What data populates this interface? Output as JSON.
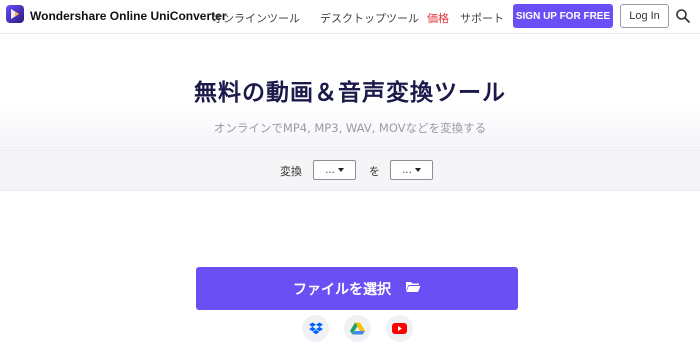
{
  "header": {
    "brand": "Wondershare Online UniConverter",
    "nav": [
      "オンラインツール",
      "デスクトップツール",
      "価格",
      "サポート"
    ],
    "signup_label": "SIGN UP FOR FREE",
    "login_label": "Log In"
  },
  "hero": {
    "title": "無料の動画＆音声変換ツール",
    "subtitle": "オンラインでMP4, MP3, WAV, MOVなどを変換する"
  },
  "converter": {
    "convert_label": "変換",
    "to_label": "を",
    "from_value": "...",
    "to_value": "..."
  },
  "upload": {
    "choose_label": "ファイルを選択"
  },
  "colors": {
    "accent": "#6a4ff4",
    "price_link": "#e5343a",
    "title": "#1b1a4a"
  },
  "icons": [
    "logo-icon",
    "search-icon",
    "folder-icon",
    "dropbox-icon",
    "google-drive-icon",
    "youtube-icon"
  ]
}
